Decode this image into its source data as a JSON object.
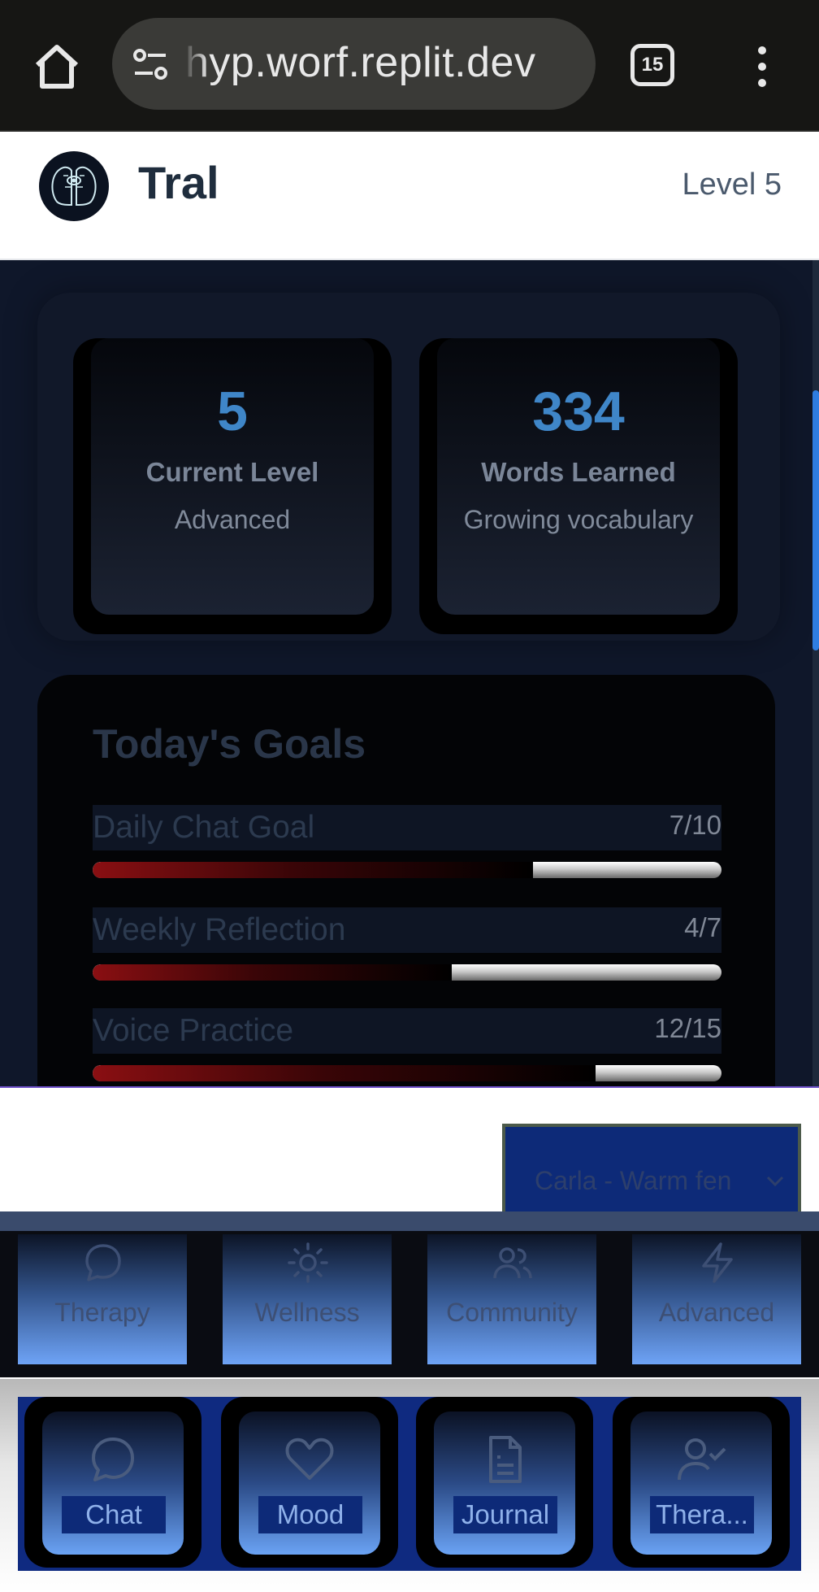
{
  "browser": {
    "url": "hyp.worf.replit.dev",
    "tab_count": "15",
    "icons": [
      "home-icon",
      "site-settings-icon",
      "tabs-icon",
      "more-menu-icon"
    ]
  },
  "header": {
    "app_name": "Tral",
    "level": "Level 5"
  },
  "stats": [
    {
      "value": "5",
      "label": "Current Level",
      "sub": "Advanced"
    },
    {
      "value": "334",
      "label": "Words Learned",
      "sub": "Growing vocabulary"
    }
  ],
  "goals": {
    "title": "Today's Goals",
    "items": [
      {
        "name": "Daily Chat Goal",
        "count": "7/10",
        "progress": 0.7
      },
      {
        "name": "Weekly Reflection",
        "count": "4/7",
        "progress": 0.571
      },
      {
        "name": "Voice Practice",
        "count": "12/15",
        "progress": 0.8
      }
    ]
  },
  "voice_select": {
    "value": "Carla - Warm fen"
  },
  "nav_primary": [
    {
      "label": "Therapy",
      "icon": "chat-bubble-icon"
    },
    {
      "label": "Wellness",
      "icon": "sun-icon"
    },
    {
      "label": "Community",
      "icon": "users-icon"
    },
    {
      "label": "Advanced",
      "icon": "lightning-icon"
    }
  ],
  "nav_secondary": [
    {
      "label": "Chat",
      "icon": "chat-bubble-icon"
    },
    {
      "label": "Mood",
      "icon": "heart-icon"
    },
    {
      "label": "Journal",
      "icon": "document-icon"
    },
    {
      "label": "Thera...",
      "icon": "user-check-icon"
    }
  ],
  "colors": {
    "accent_blue": "#3f86c8",
    "progress_red": "#8a0f12",
    "nav_blue": "#0d2a78"
  }
}
